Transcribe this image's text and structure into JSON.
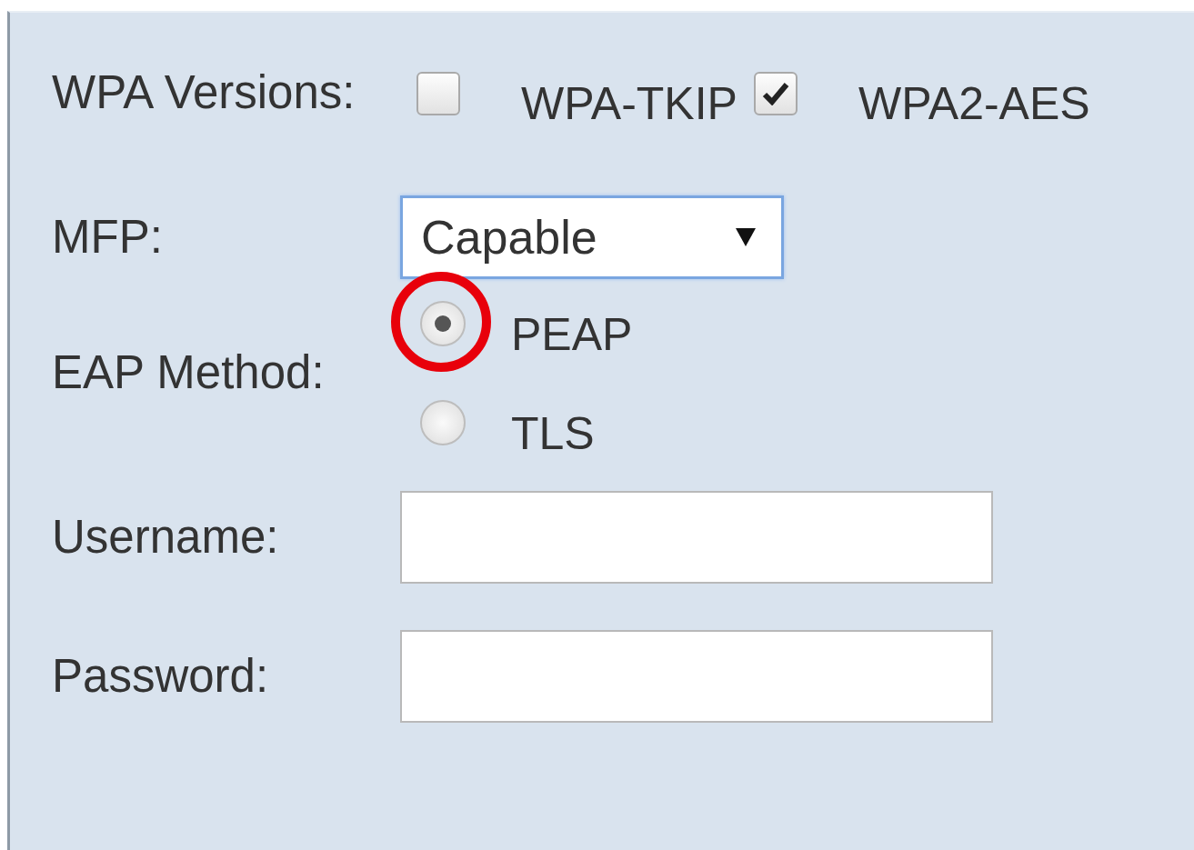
{
  "wpa_versions": {
    "label": "WPA Versions:",
    "options": [
      {
        "label": "WPA-TKIP",
        "checked": false
      },
      {
        "label": "WPA2-AES",
        "checked": true
      }
    ]
  },
  "mfp": {
    "label": "MFP:",
    "value": "Capable"
  },
  "eap_method": {
    "label": "EAP Method:",
    "options": [
      {
        "label": "PEAP",
        "selected": true,
        "highlighted": true
      },
      {
        "label": "TLS",
        "selected": false,
        "highlighted": false
      }
    ]
  },
  "username": {
    "label": "Username:"
  },
  "password": {
    "label": "Password:"
  }
}
